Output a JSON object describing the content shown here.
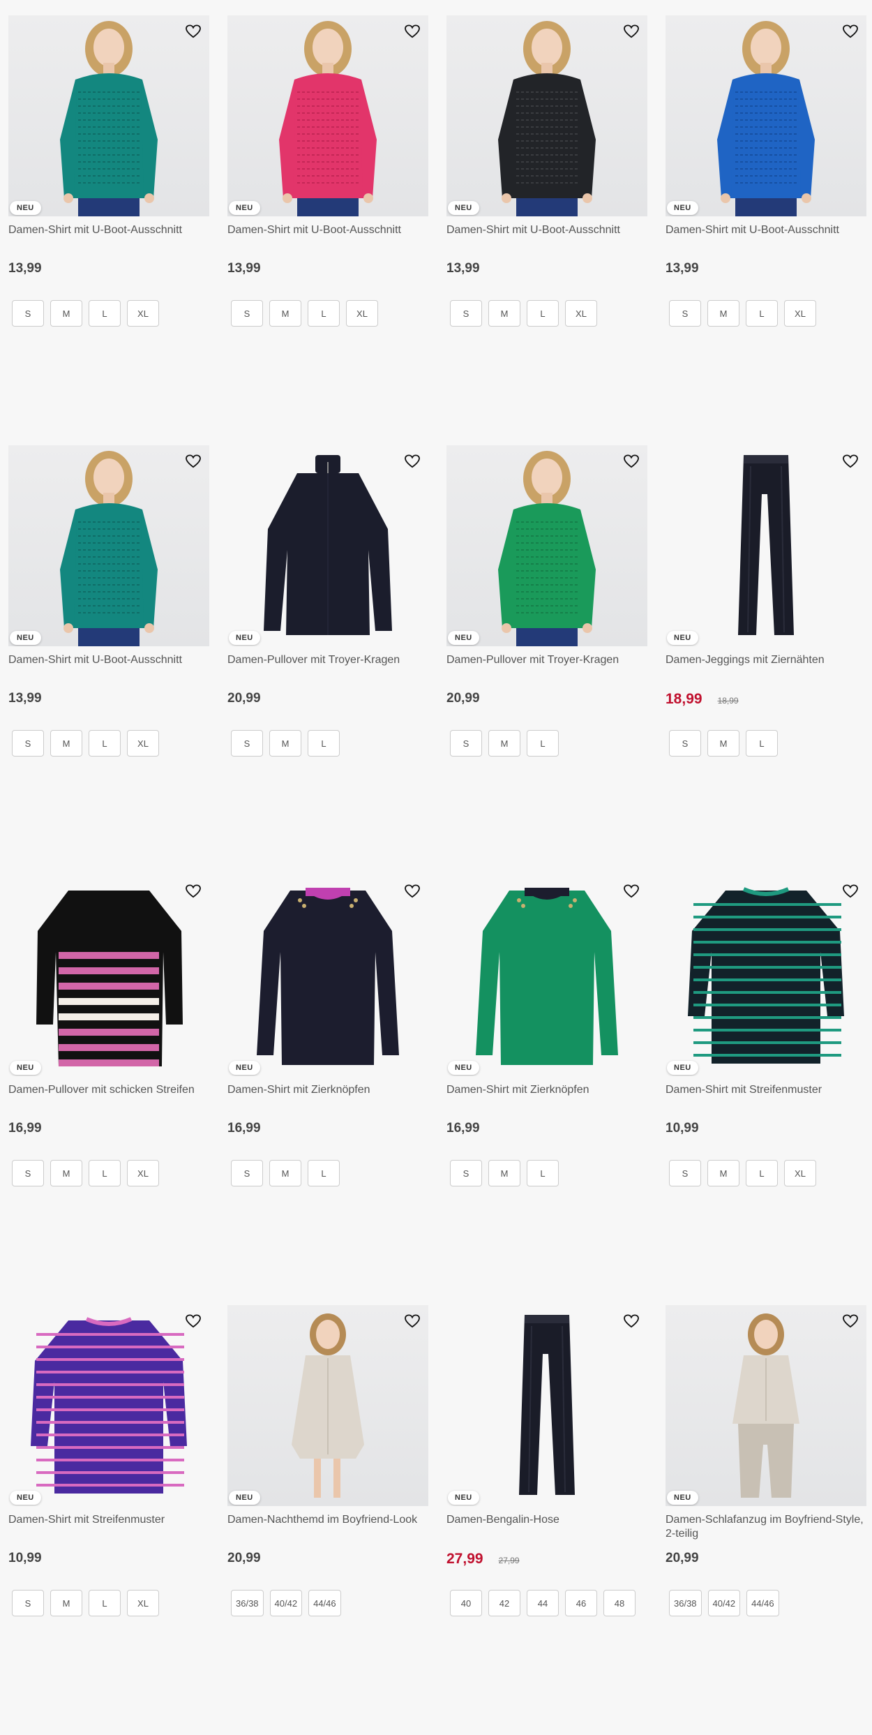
{
  "badge_label": "NEU",
  "products": [
    {
      "title": "Damen-Shirt mit U-Boot-Ausschnitt",
      "price": "13,99",
      "old_price": "",
      "sale": false,
      "sizes": [
        "S",
        "M",
        "L",
        "XL"
      ],
      "style": "model",
      "color": "#13877f",
      "color2": "#0f6d67",
      "bg": "photo"
    },
    {
      "title": "Damen-Shirt mit U-Boot-Ausschnitt",
      "price": "13,99",
      "old_price": "",
      "sale": false,
      "sizes": [
        "S",
        "M",
        "L",
        "XL"
      ],
      "style": "model",
      "color": "#e2356a",
      "color2": "#c42656",
      "bg": "photo"
    },
    {
      "title": "Damen-Shirt mit U-Boot-Ausschnitt",
      "price": "13,99",
      "old_price": "",
      "sale": false,
      "sizes": [
        "S",
        "M",
        "L",
        "XL"
      ],
      "style": "model",
      "color": "#222428",
      "color2": "#3a3c40",
      "bg": "photo"
    },
    {
      "title": "Damen-Shirt mit U-Boot-Ausschnitt",
      "price": "13,99",
      "old_price": "",
      "sale": false,
      "sizes": [
        "S",
        "M",
        "L",
        "XL"
      ],
      "style": "model",
      "color": "#1f64c4",
      "color2": "#1650a3",
      "bg": "photo"
    },
    {
      "title": "Damen-Shirt mit U-Boot-Ausschnitt",
      "price": "13,99",
      "old_price": "",
      "sale": false,
      "sizes": [
        "S",
        "M",
        "L",
        "XL"
      ],
      "style": "model",
      "color": "#13877f",
      "color2": "#0f6d67",
      "bg": "photo"
    },
    {
      "title": "Damen-Pullover mit Troyer-Kragen",
      "price": "20,99",
      "old_price": "",
      "sale": false,
      "sizes": [
        "S",
        "M",
        "L"
      ],
      "style": "troyer",
      "color": "#1b1d2c",
      "color2": "#2a2d40",
      "bg": "plain"
    },
    {
      "title": "Damen-Pullover mit Troyer-Kragen",
      "price": "20,99",
      "old_price": "",
      "sale": false,
      "sizes": [
        "S",
        "M",
        "L"
      ],
      "style": "model",
      "color": "#1a9a5a",
      "color2": "#15804a",
      "bg": "photo"
    },
    {
      "title": "Damen-Jeggings mit Ziernähten",
      "price": "18,99",
      "old_price": "18,99",
      "sale": true,
      "sizes": [
        "S",
        "M",
        "L"
      ],
      "style": "pants",
      "color": "#1a1c28",
      "color2": "#2a2c3a",
      "bg": "plain"
    },
    {
      "title": "Damen-Pullover mit schicken Streifen",
      "price": "16,99",
      "old_price": "",
      "sale": false,
      "sizes": [
        "S",
        "M",
        "L",
        "XL"
      ],
      "style": "stripesblock",
      "color": "#111",
      "color2": "#d266a8",
      "bg": "plain"
    },
    {
      "title": "Damen-Shirt mit Zierknöpfen",
      "price": "16,99",
      "old_price": "",
      "sale": false,
      "sizes": [
        "S",
        "M",
        "L"
      ],
      "style": "shirtcollar",
      "color": "#1c1d2e",
      "color2": "#c040b0",
      "bg": "plain"
    },
    {
      "title": "Damen-Shirt mit Zierknöpfen",
      "price": "16,99",
      "old_price": "",
      "sale": false,
      "sizes": [
        "S",
        "M",
        "L"
      ],
      "style": "shirtcollar",
      "color": "#149160",
      "color2": "#1c1d2e",
      "bg": "plain"
    },
    {
      "title": "Damen-Shirt mit Streifenmuster",
      "price": "10,99",
      "old_price": "",
      "sale": false,
      "sizes": [
        "S",
        "M",
        "L",
        "XL"
      ],
      "style": "stripes",
      "color": "#12222a",
      "color2": "#1f9a80",
      "bg": "plain"
    },
    {
      "title": "Damen-Shirt mit Streifenmuster",
      "price": "10,99",
      "old_price": "",
      "sale": false,
      "sizes": [
        "S",
        "M",
        "L",
        "XL"
      ],
      "style": "stripes",
      "color": "#4a2aa0",
      "color2": "#d86ac0",
      "bg": "plain"
    },
    {
      "title": "Damen-Nachthemd im Boyfriend-Look",
      "price": "20,99",
      "old_price": "",
      "sale": false,
      "sizes": [
        "36/38",
        "40/42",
        "44/46"
      ],
      "style": "dress",
      "color": "#ddd6cc",
      "color2": "#c8c0b4",
      "bg": "photo"
    },
    {
      "title": "Damen-Bengalin-Hose",
      "price": "27,99",
      "old_price": "27,99",
      "sale": true,
      "sizes": [
        "40",
        "42",
        "44",
        "46",
        "48"
      ],
      "style": "pants",
      "color": "#1a1c28",
      "color2": "#2a2c3a",
      "bg": "plain"
    },
    {
      "title": "Damen-Schlafanzug im Boyfriend-Style, 2-teilig",
      "price": "20,99",
      "old_price": "",
      "sale": false,
      "sizes": [
        "36/38",
        "40/42",
        "44/46"
      ],
      "style": "pajama",
      "color": "#ddd6cc",
      "color2": "#c8c0b4",
      "bg": "photo"
    }
  ]
}
